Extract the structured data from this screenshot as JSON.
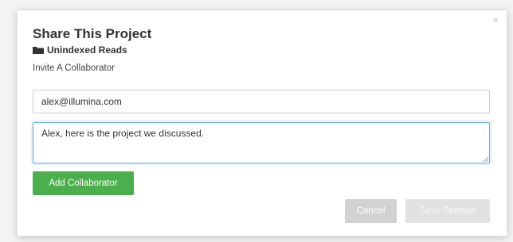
{
  "dialog": {
    "close_glyph": "×",
    "title": "Share This Project",
    "project_icon": "folder-icon",
    "project_name": "Unindexed Reads",
    "invite_label": "Invite A Collaborator",
    "email_value": "alex@illumina.com",
    "message_value": "Alex, here is the project we discussed.",
    "add_button_label": "Add Collaborator",
    "cancel_button_label": "Cancel",
    "save_button_label": "Save Settings"
  },
  "colors": {
    "add_button": "#4cae4c",
    "focus_border": "#66afe9",
    "disabled_button": "#d2d2d2"
  }
}
